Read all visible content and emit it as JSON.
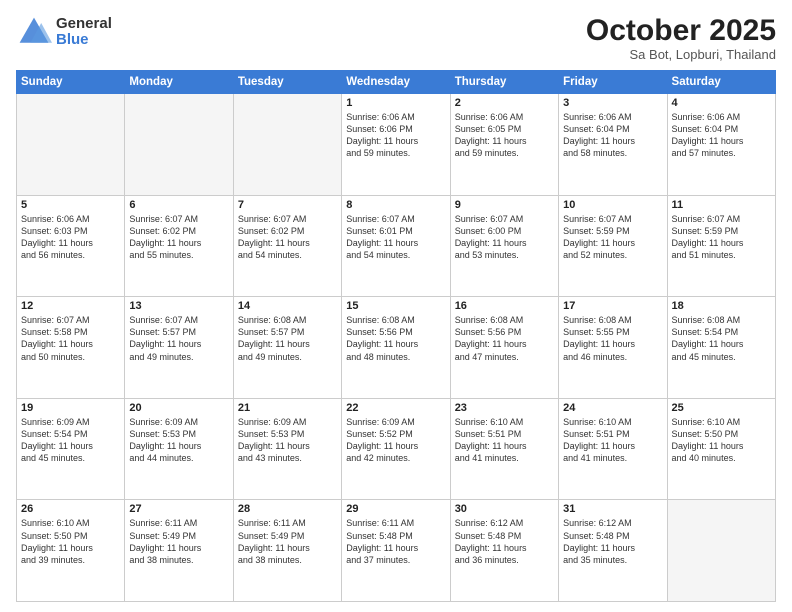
{
  "header": {
    "logo_general": "General",
    "logo_blue": "Blue",
    "month": "October 2025",
    "location": "Sa Bot, Lopburi, Thailand"
  },
  "weekdays": [
    "Sunday",
    "Monday",
    "Tuesday",
    "Wednesday",
    "Thursday",
    "Friday",
    "Saturday"
  ],
  "weeks": [
    [
      {
        "day": "",
        "text": ""
      },
      {
        "day": "",
        "text": ""
      },
      {
        "day": "",
        "text": ""
      },
      {
        "day": "1",
        "text": "Sunrise: 6:06 AM\nSunset: 6:06 PM\nDaylight: 11 hours\nand 59 minutes."
      },
      {
        "day": "2",
        "text": "Sunrise: 6:06 AM\nSunset: 6:05 PM\nDaylight: 11 hours\nand 59 minutes."
      },
      {
        "day": "3",
        "text": "Sunrise: 6:06 AM\nSunset: 6:04 PM\nDaylight: 11 hours\nand 58 minutes."
      },
      {
        "day": "4",
        "text": "Sunrise: 6:06 AM\nSunset: 6:04 PM\nDaylight: 11 hours\nand 57 minutes."
      }
    ],
    [
      {
        "day": "5",
        "text": "Sunrise: 6:06 AM\nSunset: 6:03 PM\nDaylight: 11 hours\nand 56 minutes."
      },
      {
        "day": "6",
        "text": "Sunrise: 6:07 AM\nSunset: 6:02 PM\nDaylight: 11 hours\nand 55 minutes."
      },
      {
        "day": "7",
        "text": "Sunrise: 6:07 AM\nSunset: 6:02 PM\nDaylight: 11 hours\nand 54 minutes."
      },
      {
        "day": "8",
        "text": "Sunrise: 6:07 AM\nSunset: 6:01 PM\nDaylight: 11 hours\nand 54 minutes."
      },
      {
        "day": "9",
        "text": "Sunrise: 6:07 AM\nSunset: 6:00 PM\nDaylight: 11 hours\nand 53 minutes."
      },
      {
        "day": "10",
        "text": "Sunrise: 6:07 AM\nSunset: 5:59 PM\nDaylight: 11 hours\nand 52 minutes."
      },
      {
        "day": "11",
        "text": "Sunrise: 6:07 AM\nSunset: 5:59 PM\nDaylight: 11 hours\nand 51 minutes."
      }
    ],
    [
      {
        "day": "12",
        "text": "Sunrise: 6:07 AM\nSunset: 5:58 PM\nDaylight: 11 hours\nand 50 minutes."
      },
      {
        "day": "13",
        "text": "Sunrise: 6:07 AM\nSunset: 5:57 PM\nDaylight: 11 hours\nand 49 minutes."
      },
      {
        "day": "14",
        "text": "Sunrise: 6:08 AM\nSunset: 5:57 PM\nDaylight: 11 hours\nand 49 minutes."
      },
      {
        "day": "15",
        "text": "Sunrise: 6:08 AM\nSunset: 5:56 PM\nDaylight: 11 hours\nand 48 minutes."
      },
      {
        "day": "16",
        "text": "Sunrise: 6:08 AM\nSunset: 5:56 PM\nDaylight: 11 hours\nand 47 minutes."
      },
      {
        "day": "17",
        "text": "Sunrise: 6:08 AM\nSunset: 5:55 PM\nDaylight: 11 hours\nand 46 minutes."
      },
      {
        "day": "18",
        "text": "Sunrise: 6:08 AM\nSunset: 5:54 PM\nDaylight: 11 hours\nand 45 minutes."
      }
    ],
    [
      {
        "day": "19",
        "text": "Sunrise: 6:09 AM\nSunset: 5:54 PM\nDaylight: 11 hours\nand 45 minutes."
      },
      {
        "day": "20",
        "text": "Sunrise: 6:09 AM\nSunset: 5:53 PM\nDaylight: 11 hours\nand 44 minutes."
      },
      {
        "day": "21",
        "text": "Sunrise: 6:09 AM\nSunset: 5:53 PM\nDaylight: 11 hours\nand 43 minutes."
      },
      {
        "day": "22",
        "text": "Sunrise: 6:09 AM\nSunset: 5:52 PM\nDaylight: 11 hours\nand 42 minutes."
      },
      {
        "day": "23",
        "text": "Sunrise: 6:10 AM\nSunset: 5:51 PM\nDaylight: 11 hours\nand 41 minutes."
      },
      {
        "day": "24",
        "text": "Sunrise: 6:10 AM\nSunset: 5:51 PM\nDaylight: 11 hours\nand 41 minutes."
      },
      {
        "day": "25",
        "text": "Sunrise: 6:10 AM\nSunset: 5:50 PM\nDaylight: 11 hours\nand 40 minutes."
      }
    ],
    [
      {
        "day": "26",
        "text": "Sunrise: 6:10 AM\nSunset: 5:50 PM\nDaylight: 11 hours\nand 39 minutes."
      },
      {
        "day": "27",
        "text": "Sunrise: 6:11 AM\nSunset: 5:49 PM\nDaylight: 11 hours\nand 38 minutes."
      },
      {
        "day": "28",
        "text": "Sunrise: 6:11 AM\nSunset: 5:49 PM\nDaylight: 11 hours\nand 38 minutes."
      },
      {
        "day": "29",
        "text": "Sunrise: 6:11 AM\nSunset: 5:48 PM\nDaylight: 11 hours\nand 37 minutes."
      },
      {
        "day": "30",
        "text": "Sunrise: 6:12 AM\nSunset: 5:48 PM\nDaylight: 11 hours\nand 36 minutes."
      },
      {
        "day": "31",
        "text": "Sunrise: 6:12 AM\nSunset: 5:48 PM\nDaylight: 11 hours\nand 35 minutes."
      },
      {
        "day": "",
        "text": ""
      }
    ]
  ]
}
